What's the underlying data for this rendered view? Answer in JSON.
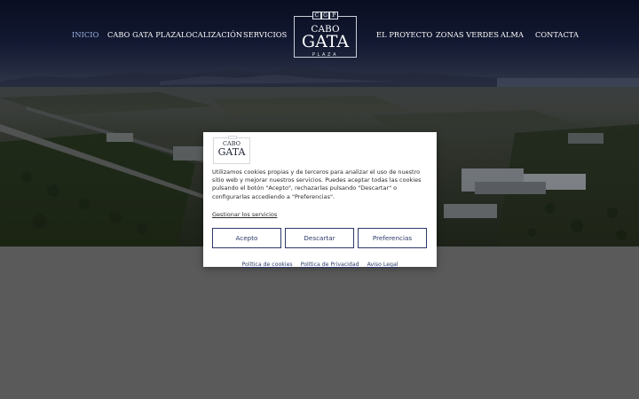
{
  "nav": {
    "left": [
      {
        "label": "INICIO",
        "active": true
      },
      {
        "label": "CABO GATA PLAZA",
        "active": false
      },
      {
        "label": "LOCALIZACIÓN",
        "active": false
      },
      {
        "label": "SERVICIOS",
        "active": false
      }
    ],
    "right": [
      {
        "label": "EL PROYECTO",
        "active": false
      },
      {
        "label": "ZONAS VERDES",
        "active": false
      },
      {
        "label": "ALMA",
        "active": false
      },
      {
        "label": "CONTACTA",
        "active": false
      }
    ]
  },
  "logo": {
    "badge": [
      "C",
      "G",
      "P"
    ],
    "line1": "CABO",
    "line2": "GATA",
    "line3": "PLAZA"
  },
  "colors": {
    "nav_active": "#9fb3e3",
    "button_border": "#2d3a6b",
    "modal_bg": "#ffffff",
    "page_bg": "#595959"
  },
  "cookie_modal": {
    "logo_top": "CABO",
    "logo_main": "GATA",
    "text": "Utilizamos cookies propias y de terceros para analizar el uso de nuestro sitio web y mejorar nuestros servicios. Puedes aceptar todas las cookies pulsando el botón \"Acepto\", rechazarlas pulsando \"Descartar\" o configurarlas accediendo a \"Preferencias\".",
    "manage_label": "Gestionar los servicios",
    "buttons": {
      "accept": "Acepto",
      "reject": "Descartar",
      "preferences": "Preferencias"
    },
    "links": {
      "cookies_policy": "Política de cookies",
      "privacy_policy": "Política de Privacidad",
      "legal_notice": "Aviso Legal"
    }
  }
}
